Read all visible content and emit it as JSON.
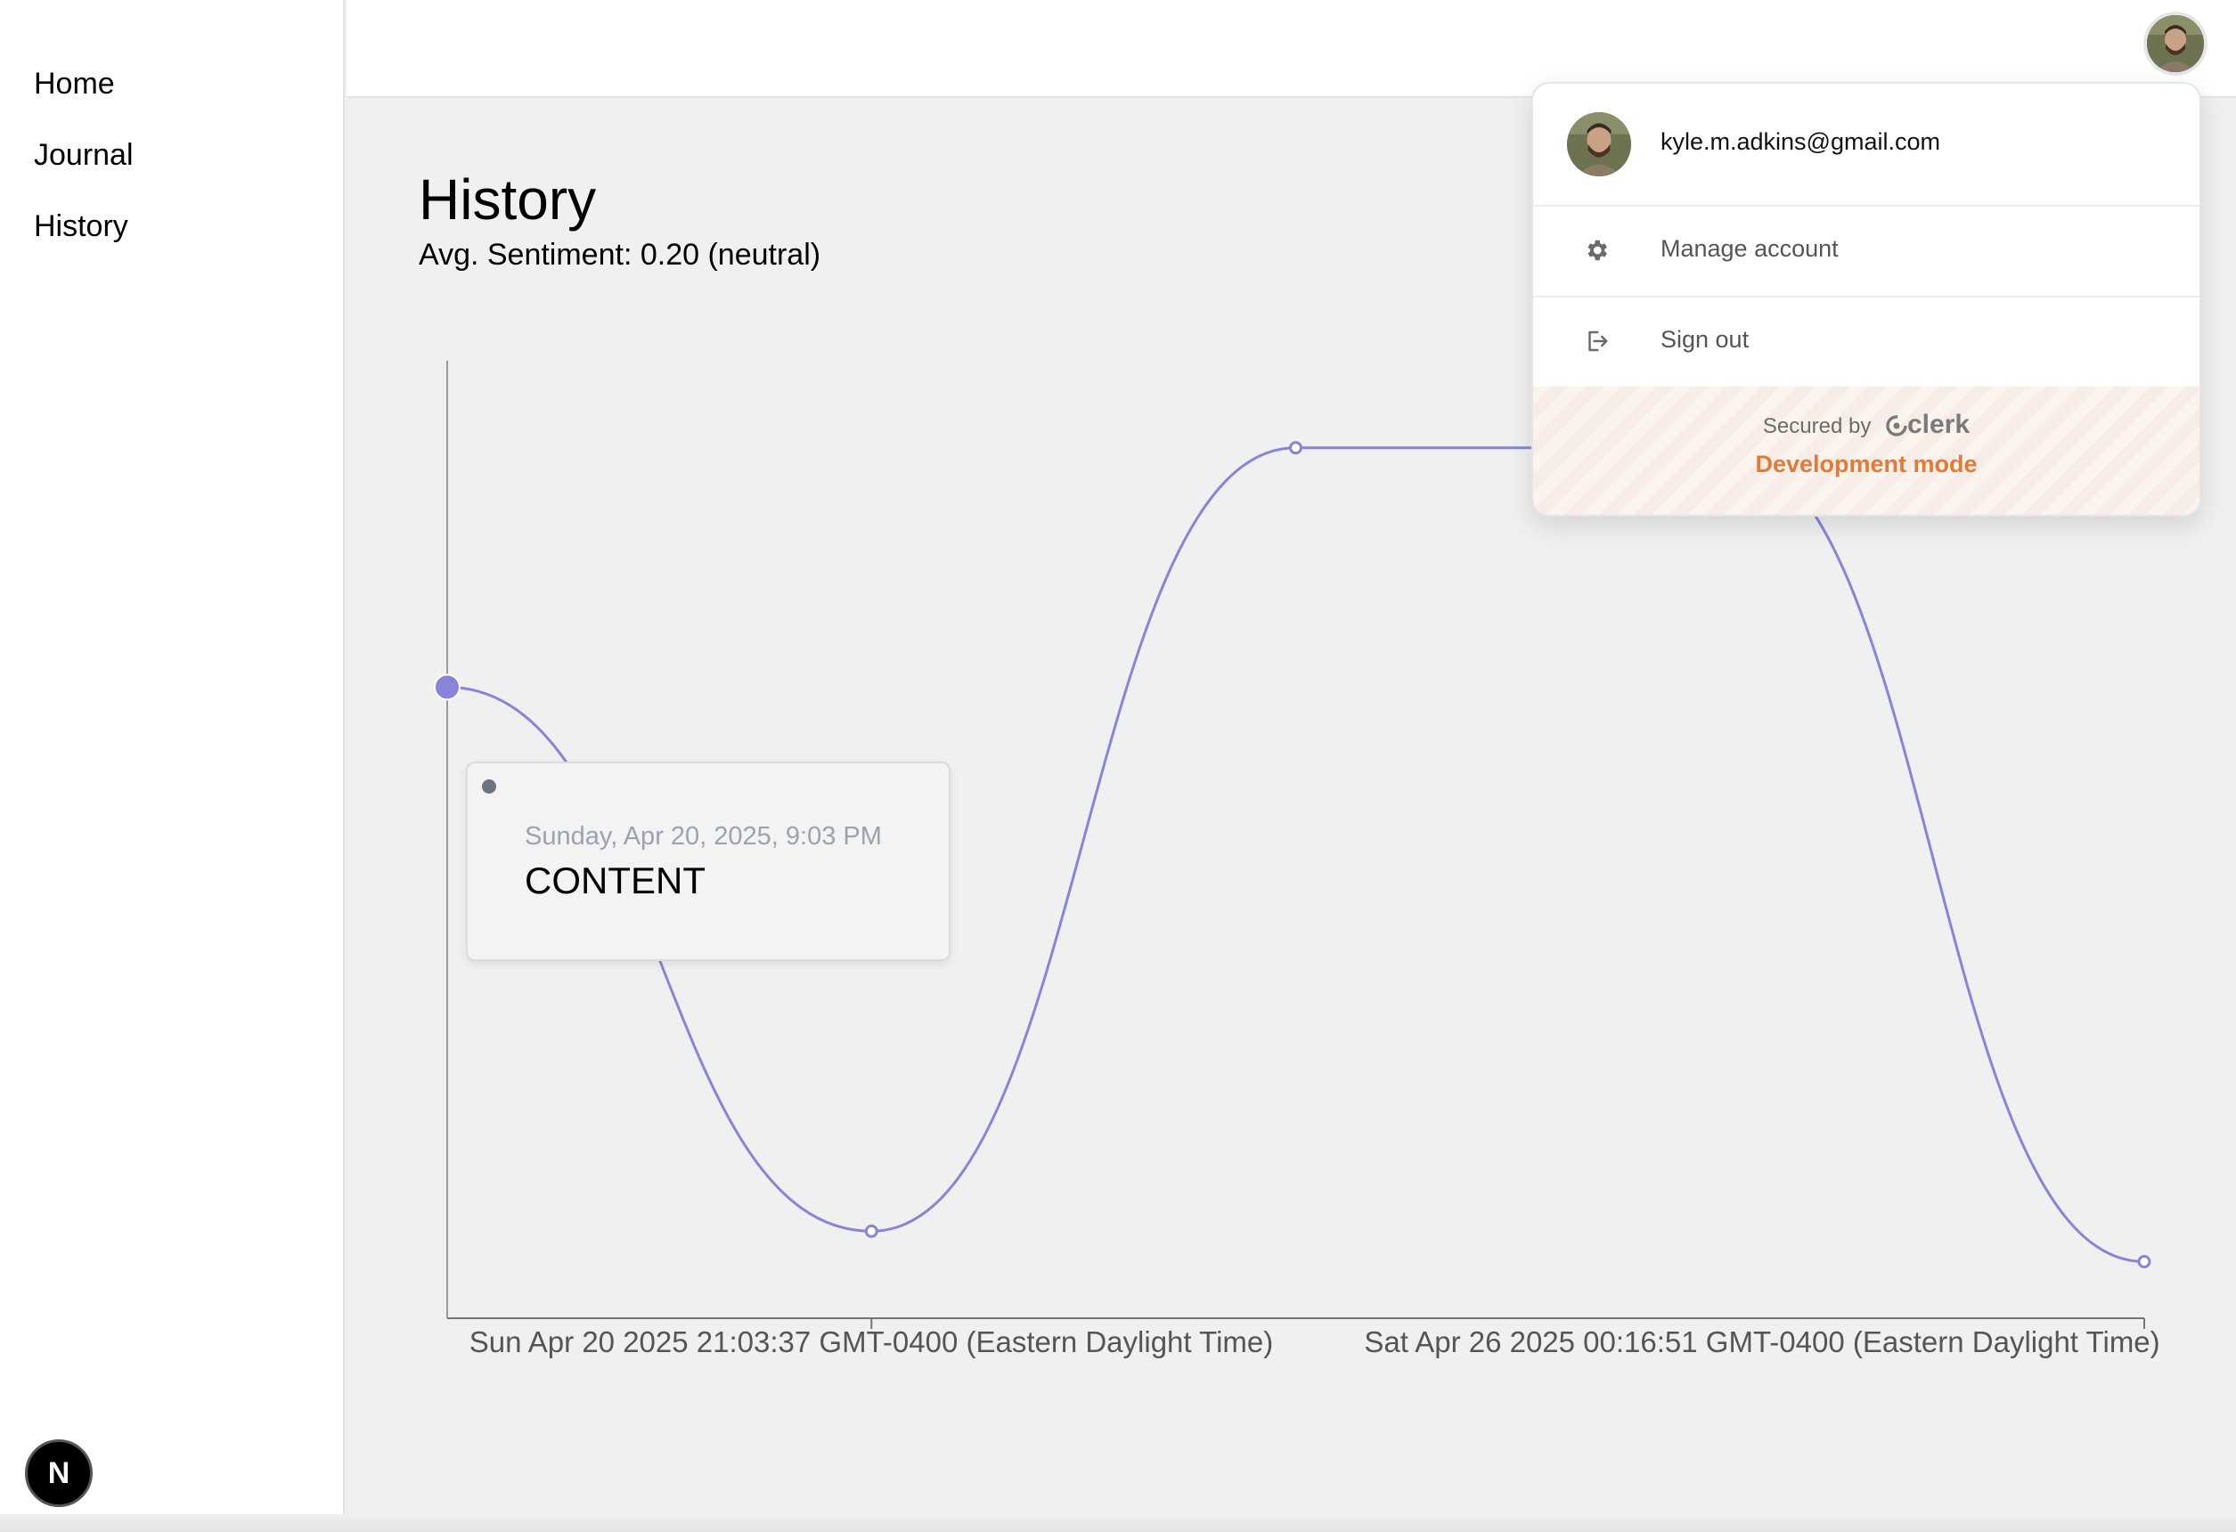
{
  "sidebar": {
    "items": [
      {
        "label": "Home"
      },
      {
        "label": "Journal"
      },
      {
        "label": "History"
      }
    ]
  },
  "page": {
    "title": "History",
    "subtitle": "Avg. Sentiment: 0.20 (neutral)"
  },
  "tooltip": {
    "date": "Sunday, Apr 20, 2025, 9:03 PM",
    "content": "CONTENT"
  },
  "user_menu": {
    "email": "kyle.m.adkins@gmail.com",
    "items": [
      {
        "label": "Manage account",
        "icon": "gear-icon"
      },
      {
        "label": "Sign out",
        "icon": "sign-out-icon"
      }
    ],
    "secured_by": "Secured by",
    "brand": "clerk",
    "dev_mode": "Development mode"
  },
  "nextjs_badge": "N",
  "colors": {
    "line": "#8884d8",
    "dev_mode": "#e07b39"
  },
  "chart_data": {
    "type": "line",
    "x_tick_labels": [
      "Sun Apr 20 2025 21:03:37 GMT-0400 (Eastern Daylight Time)",
      "Sat Apr 26 2025 00:16:51 GMT-0400 (Eastern Daylight Time)"
    ],
    "points_count": 5,
    "values": [
      0.35,
      -0.9,
      0.9,
      0.9,
      -0.97
    ],
    "ylim": [
      -1.1,
      1.1
    ],
    "active_index": 0,
    "grid": false,
    "y_axis_labels": false
  }
}
